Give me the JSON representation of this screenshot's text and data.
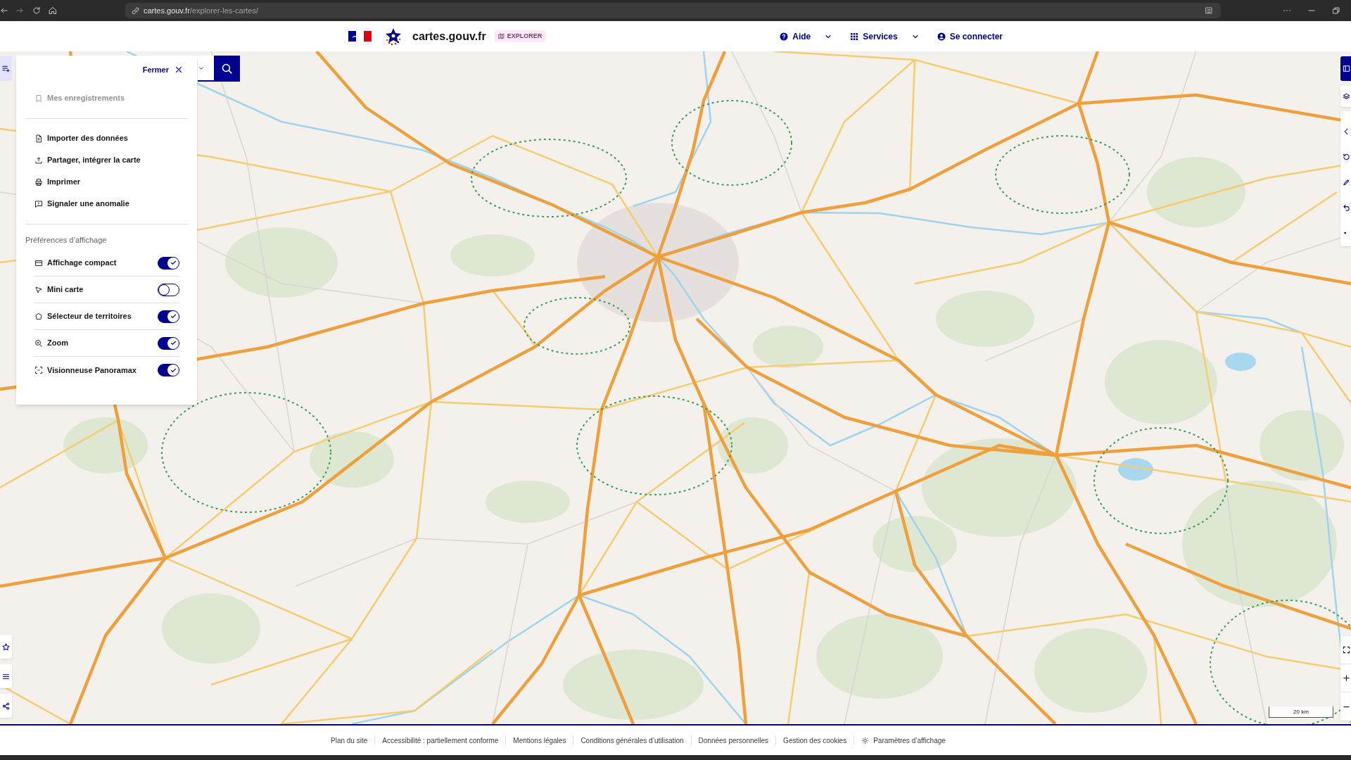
{
  "browser": {
    "url_host": "cartes.gouv.fr",
    "url_path": "/explorer-les-cartes/"
  },
  "header": {
    "site_name": "cartes.gouv.fr",
    "badge": "EXPLORER",
    "nav": [
      {
        "label": "Aide",
        "kind": "help"
      },
      {
        "label": "Services",
        "kind": "services"
      },
      {
        "label": "Se connecter",
        "kind": "account"
      }
    ]
  },
  "panel": {
    "close_label": "Fermer",
    "sections": [
      {
        "items": [
          {
            "label": "Mes enregistrements",
            "disabled": true
          }
        ]
      },
      {
        "items": [
          {
            "label": "Importer des données",
            "disabled": false
          },
          {
            "label": "Partager, intégrer la carte",
            "disabled": false
          },
          {
            "label": "Imprimer",
            "disabled": false
          },
          {
            "label": "Signaler une anomalie",
            "disabled": false
          }
        ]
      }
    ],
    "preferences_title": "Préférences d’affichage",
    "preferences": [
      {
        "label": "Affichage compact",
        "on": true
      },
      {
        "label": "Mini carte",
        "on": false
      },
      {
        "label": "Sélecteur de territoires",
        "on": true
      },
      {
        "label": "Zoom",
        "on": true
      },
      {
        "label": "Visionneuse Panoramax",
        "on": true
      }
    ]
  },
  "map": {
    "scale_label": "20 km"
  },
  "footer": {
    "links": [
      {
        "label": "Plan du site",
        "kind": "link"
      },
      {
        "label": "Accessibilité : partiellement conforme",
        "kind": "link"
      },
      {
        "label": "Mentions légales",
        "kind": "link"
      },
      {
        "label": "Conditions générales d’utilisation",
        "kind": "link"
      },
      {
        "label": "Données personnelles",
        "kind": "link"
      },
      {
        "label": "Gestion des cookies",
        "kind": "link"
      },
      {
        "label": "Paramètres d’affichage",
        "kind": "settings"
      }
    ]
  }
}
